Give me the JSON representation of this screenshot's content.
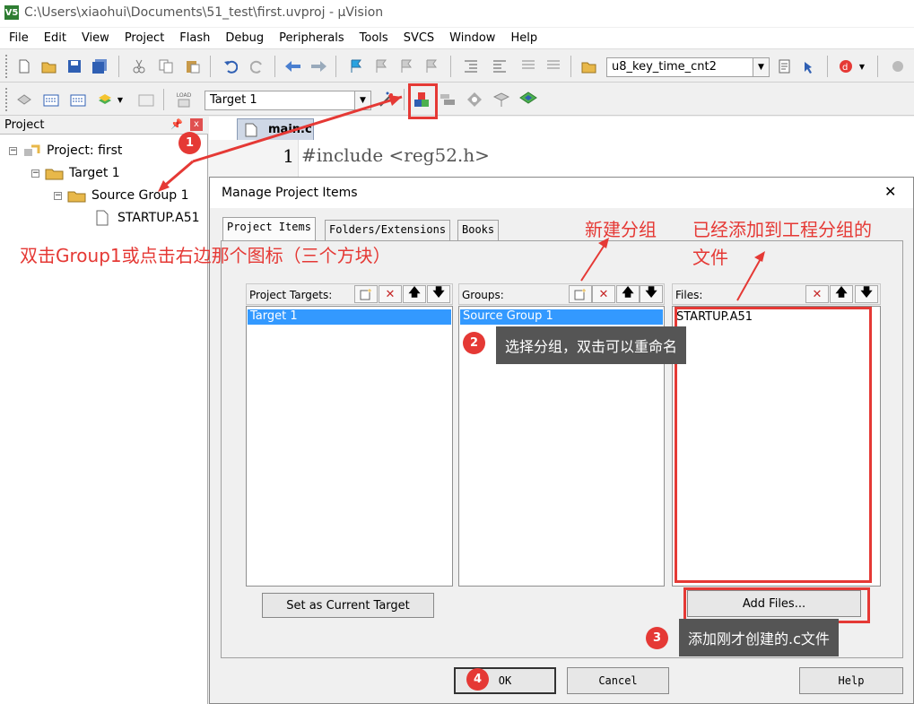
{
  "window": {
    "title": "C:\\Users\\xiaohui\\Documents\\51_test\\first.uvproj - µVision",
    "app_icon": "V5"
  },
  "menu": [
    "File",
    "Edit",
    "View",
    "Project",
    "Flash",
    "Debug",
    "Peripherals",
    "Tools",
    "SVCS",
    "Window",
    "Help"
  ],
  "toolbar1": {
    "target_combo": "u8_key_time_cnt2"
  },
  "toolbar2": {
    "target_select": "Target 1",
    "load_label": "LOAD"
  },
  "project_pane": {
    "title": "Project",
    "tree": [
      {
        "label": "Project: first"
      },
      {
        "label": "Target 1"
      },
      {
        "label": "Source Group 1"
      },
      {
        "label": "STARTUP.A51"
      }
    ]
  },
  "editor": {
    "tab": "main.c",
    "line_number": "1",
    "code": "#include <reg52.h>"
  },
  "dialog": {
    "title": "Manage Project Items",
    "close": "✕",
    "tabs": [
      "Project Items",
      "Folders/Extensions",
      "Books"
    ],
    "targets": {
      "label": "Project Targets:",
      "items": [
        "Target 1"
      ]
    },
    "groups": {
      "label": "Groups:",
      "items": [
        "Source Group 1"
      ]
    },
    "files": {
      "label": "Files:",
      "items": [
        "STARTUP.A51"
      ]
    },
    "set_current": "Set as Current Target",
    "add_files": "Add Files...",
    "ok": "OK",
    "cancel": "Cancel",
    "help": "Help"
  },
  "annotations": {
    "step1_text": "双击Group1或点击右边那个图标（三个方块）",
    "new_group_text": "新建分组",
    "added_files_line1": "已经添加到工程分组的",
    "added_files_line2": "文件",
    "step2_tip": "选择分组，双击可以重命名",
    "step3_tip": "添加刚才创建的.c文件",
    "badges": [
      "1",
      "2",
      "3",
      "4"
    ],
    "color": "#e53935"
  }
}
